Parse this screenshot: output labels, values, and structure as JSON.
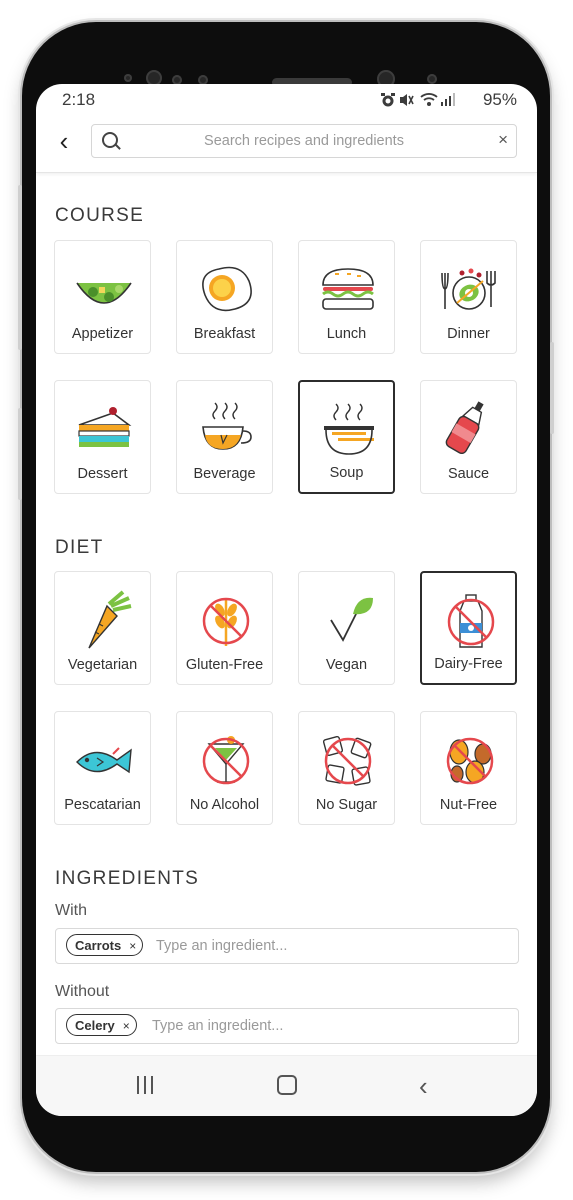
{
  "status": {
    "time": "2:18",
    "battery": "95%"
  },
  "search": {
    "placeholder": "Search recipes and ingredients",
    "clear": "×",
    "back": "‹"
  },
  "course": {
    "title": "COURSE",
    "items": [
      {
        "label": "Appetizer",
        "icon": "salad-bowl-icon",
        "selected": false
      },
      {
        "label": "Breakfast",
        "icon": "fried-egg-icon",
        "selected": false
      },
      {
        "label": "Lunch",
        "icon": "burger-icon",
        "selected": false
      },
      {
        "label": "Dinner",
        "icon": "dinner-plate-icon",
        "selected": false
      },
      {
        "label": "Dessert",
        "icon": "cake-slice-icon",
        "selected": false
      },
      {
        "label": "Beverage",
        "icon": "tea-cup-icon",
        "selected": false
      },
      {
        "label": "Soup",
        "icon": "soup-bowl-icon",
        "selected": true
      },
      {
        "label": "Sauce",
        "icon": "sauce-bottle-icon",
        "selected": false
      }
    ]
  },
  "diet": {
    "title": "DIET",
    "items": [
      {
        "label": "Vegetarian",
        "icon": "carrot-icon",
        "selected": false
      },
      {
        "label": "Gluten-Free",
        "icon": "no-wheat-icon",
        "selected": false
      },
      {
        "label": "Vegan",
        "icon": "vegan-leaf-icon",
        "selected": false
      },
      {
        "label": "Dairy-Free",
        "icon": "no-milk-icon",
        "selected": true
      },
      {
        "label": "Pescatarian",
        "icon": "fish-icon",
        "selected": false
      },
      {
        "label": "No Alcohol",
        "icon": "no-cocktail-icon",
        "selected": false
      },
      {
        "label": "No Sugar",
        "icon": "no-sugar-icon",
        "selected": false
      },
      {
        "label": "Nut-Free",
        "icon": "no-nuts-icon",
        "selected": false
      }
    ]
  },
  "ingredients": {
    "title": "INGREDIENTS",
    "with_label": "With",
    "with_chip": "Carrots",
    "with_placeholder": "Type an ingredient...",
    "without_label": "Without",
    "without_chip": "Celery",
    "without_placeholder": "Type an ingredient...",
    "chip_remove": "×"
  },
  "colors": {
    "accent_green": "#7cc242",
    "accent_orange": "#f5a623",
    "accent_red": "#e5484d",
    "accent_teal": "#3cc6d6"
  }
}
